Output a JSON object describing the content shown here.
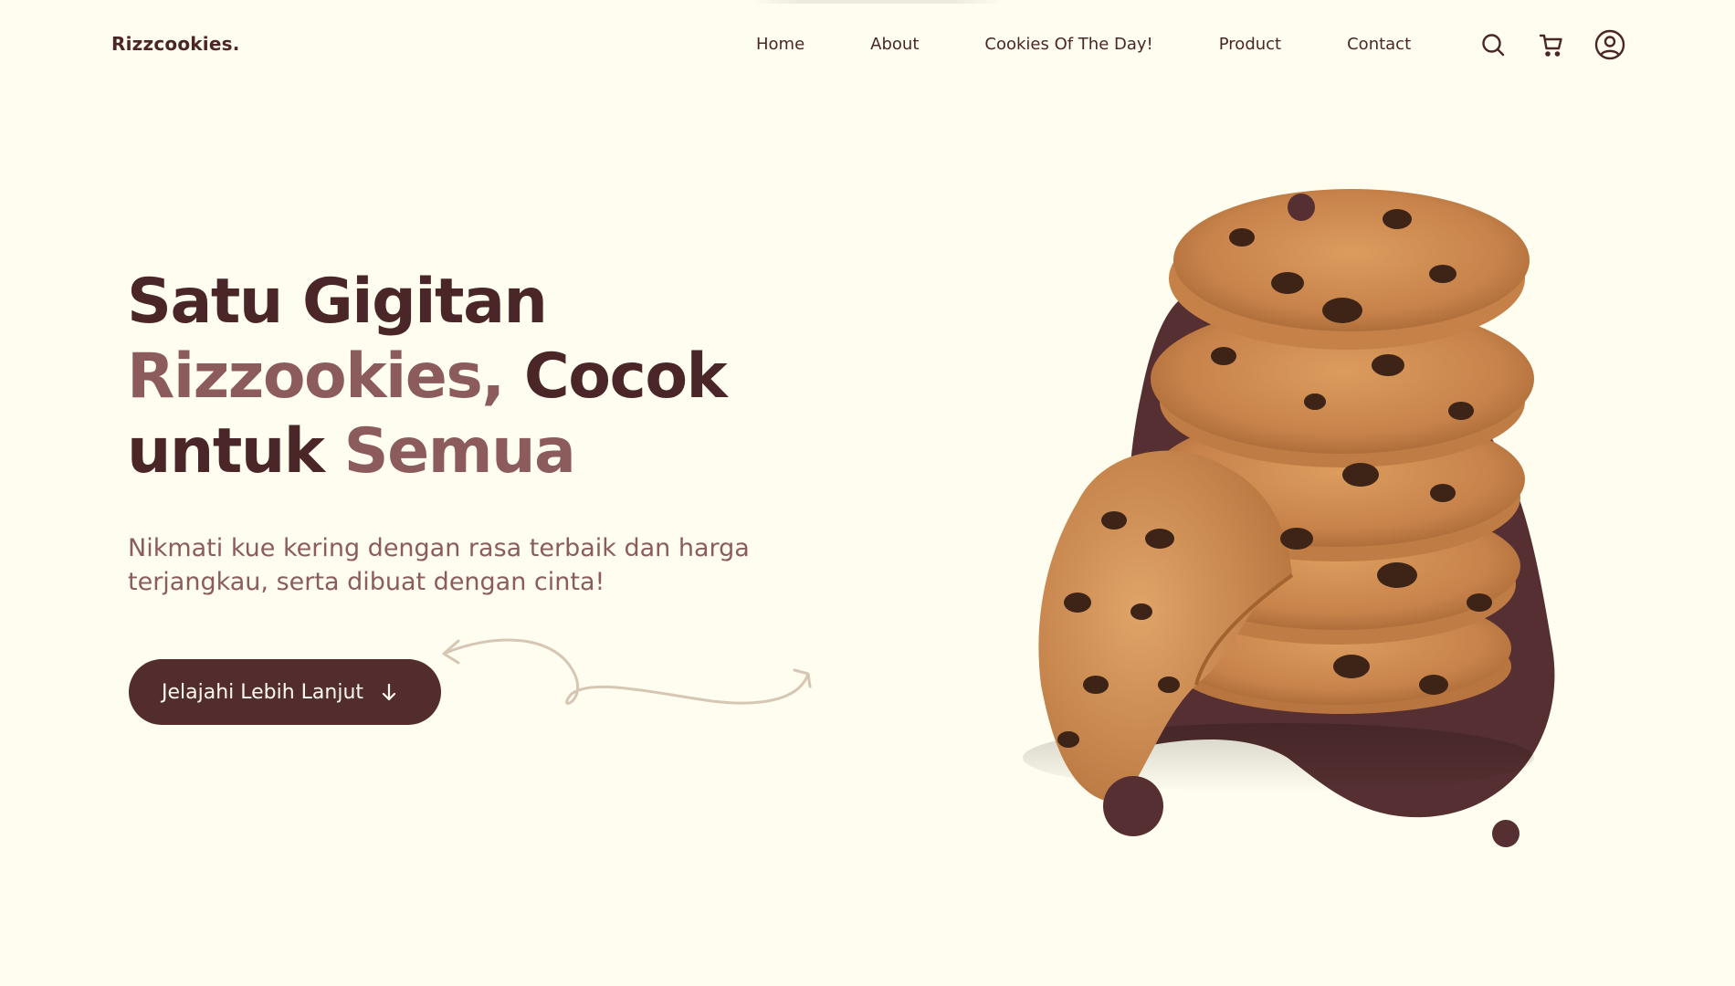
{
  "brand": {
    "name": "Rizzcookies."
  },
  "nav": {
    "links": [
      "Home",
      "About",
      "Cookies Of The Day!",
      "Product",
      "Contact"
    ],
    "icons": [
      "search-icon",
      "cart-icon",
      "user-account-icon"
    ]
  },
  "hero": {
    "title": {
      "line1": "Satu Gigitan",
      "line2_accent": "Rizzookies,",
      "line2_rest": " Cocok",
      "line3_start": "untuk ",
      "line3_accent": "Semua"
    },
    "subtitle": "Nikmati kue kering dengan rasa terbaik dan harga terjangkau, serta dibuat dengan cinta!",
    "cta": {
      "label": "Jelajahi Lebih Lanjut",
      "icon": "arrow-down-icon"
    }
  },
  "colors": {
    "background": "#fffdef",
    "primary": "#4a2628",
    "accent": "#8c5c5c",
    "button": "#532c2e",
    "blob": "#552f31",
    "cookie": "#cc8a4e"
  }
}
